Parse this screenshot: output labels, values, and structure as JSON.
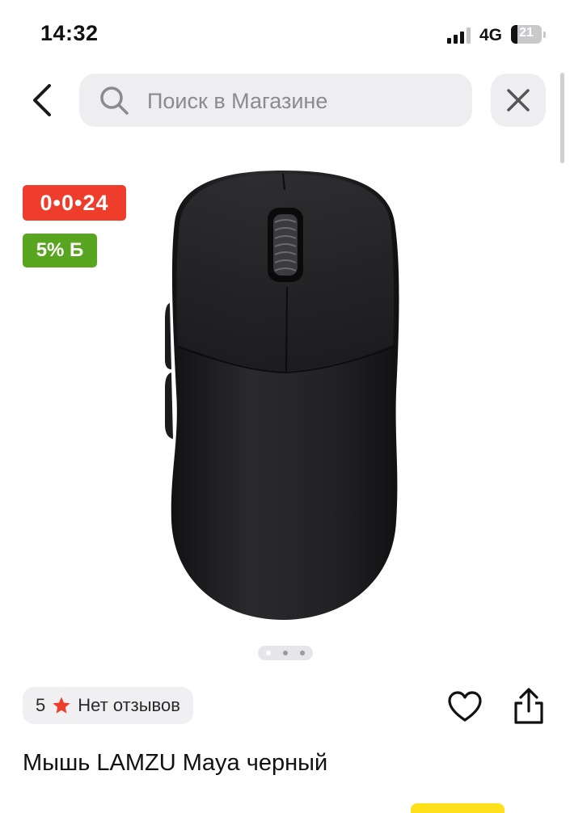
{
  "status_bar": {
    "time": "14:32",
    "network": "4G",
    "battery_level": "21",
    "signal_bars_active": 3,
    "signal_bars_total": 4
  },
  "header": {
    "search_placeholder": "Поиск в Магазине",
    "back_icon": "chevron-left-icon",
    "close_icon": "close-icon"
  },
  "product": {
    "timer_badge": "0•0•24",
    "cashback_badge": "5% Б",
    "gallery_pages": 3,
    "gallery_active": 1,
    "rating_value": "5",
    "reviews_text": "Нет отзывов",
    "title": "Мышь LAMZU Maya черный"
  },
  "colors": {
    "timer_badge": "#ef3d2c",
    "cashback_badge": "#58a61f",
    "star": "#ef3d2c",
    "search_bg": "#eeeef0"
  }
}
